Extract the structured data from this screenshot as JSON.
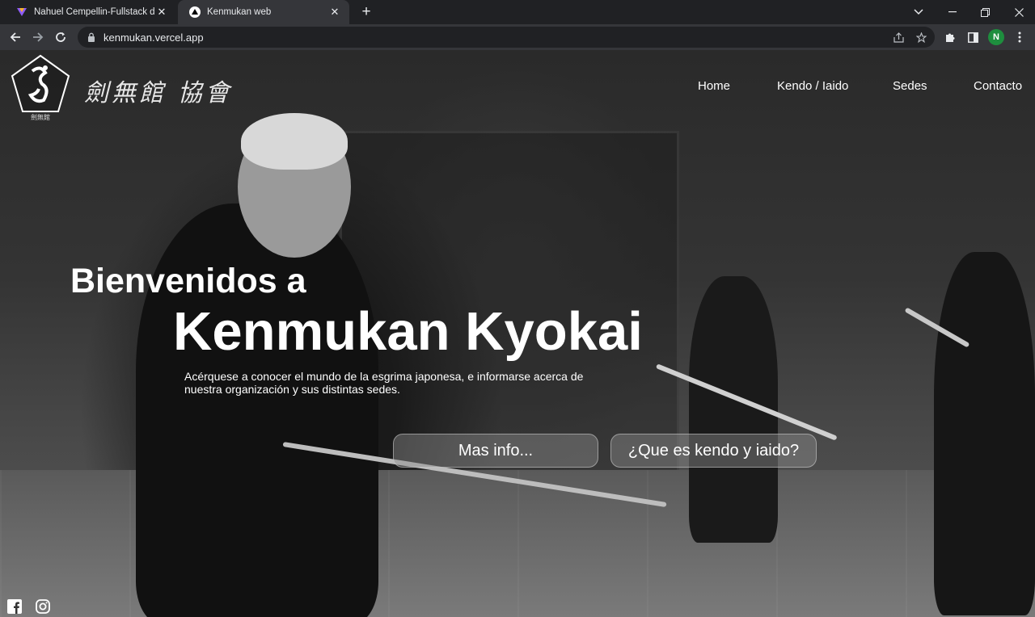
{
  "browser": {
    "tabs": [
      {
        "title": "Nahuel Cempellin-Fullstack dev.",
        "close": "✕"
      },
      {
        "title": "Kenmukan web",
        "close": "✕"
      }
    ],
    "new_tab": "+",
    "address": "kenmukan.vercel.app",
    "profile_initial": "N"
  },
  "site": {
    "logo_caption": "劍無館",
    "logo_text": "劍無館 協會",
    "nav": [
      "Home",
      "Kendo / Iaido",
      "Sedes",
      "Contacto"
    ],
    "hero": {
      "welcome": "Bienvenidos a",
      "brand": "Kenmukan Kyokai",
      "description": "Acérquese a conocer el mundo de la esgrima japonesa, e informarse acerca de nuestra organización y sus distintas sedes.",
      "button_primary": "Mas info...",
      "button_secondary": "¿Que es kendo y iaido?"
    },
    "social": [
      "facebook-icon",
      "instagram-icon"
    ]
  }
}
